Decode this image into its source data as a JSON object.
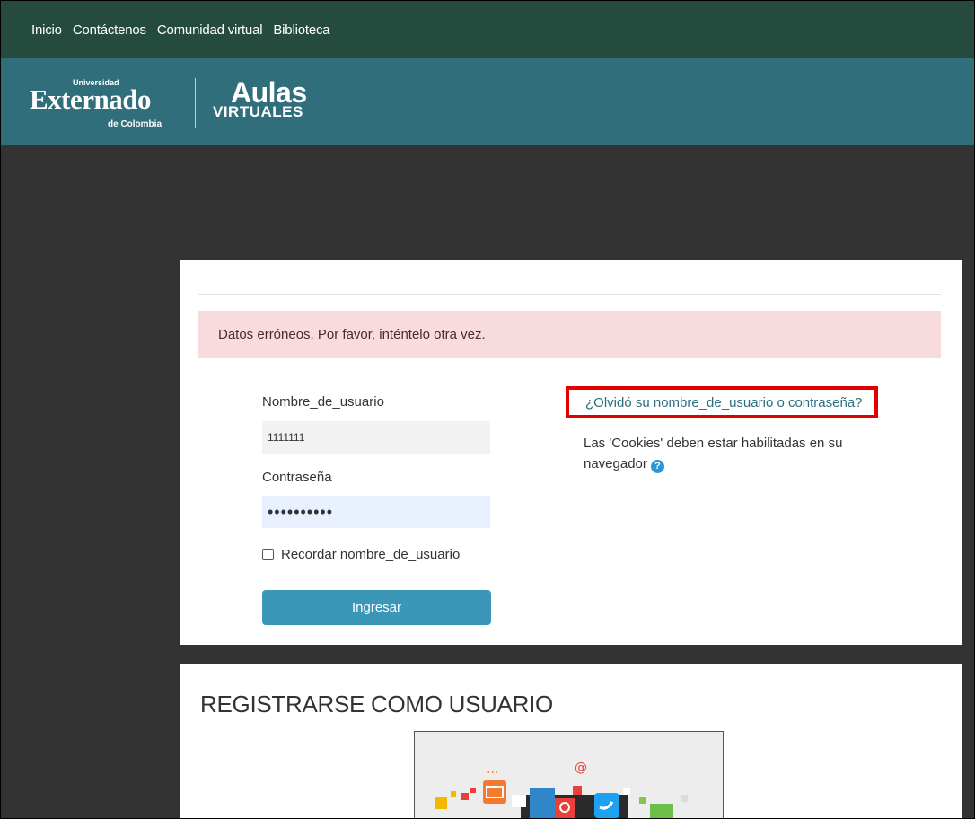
{
  "nav": {
    "items": [
      "Inicio",
      "Contáctenos",
      "Comunidad virtual",
      "Biblioteca"
    ]
  },
  "logo": {
    "universidad": "Universidad",
    "externado": "Externado",
    "de_colombia": "de Colombia",
    "aulas": "Aulas",
    "virtuales": "VIRTUALES"
  },
  "login": {
    "error_message": "Datos erróneos. Por favor, inténtelo otra vez.",
    "username_label": "Nombre_de_usuario",
    "username_value": "1111111",
    "password_label": "Contraseña",
    "password_value": "••••••••••",
    "remember_label": "Recordar nombre_de_usuario",
    "submit_label": "Ingresar",
    "forgot_link": "¿Olvidó su nombre_de_usuario o contraseña?",
    "cookies_text": "Las 'Cookies' deben estar habilitadas en su navegador",
    "help_icon": "question-circle-icon"
  },
  "register": {
    "title": "REGISTRARSE COMO USUARIO"
  },
  "colors": {
    "nav_bg": "#254a3e",
    "header_bg": "#2f6e7a",
    "page_bg": "#333333",
    "alert_bg": "#f8dcdd",
    "button_bg": "#3b97b8",
    "highlight_border": "#e00000",
    "link": "#2b6e7d"
  }
}
